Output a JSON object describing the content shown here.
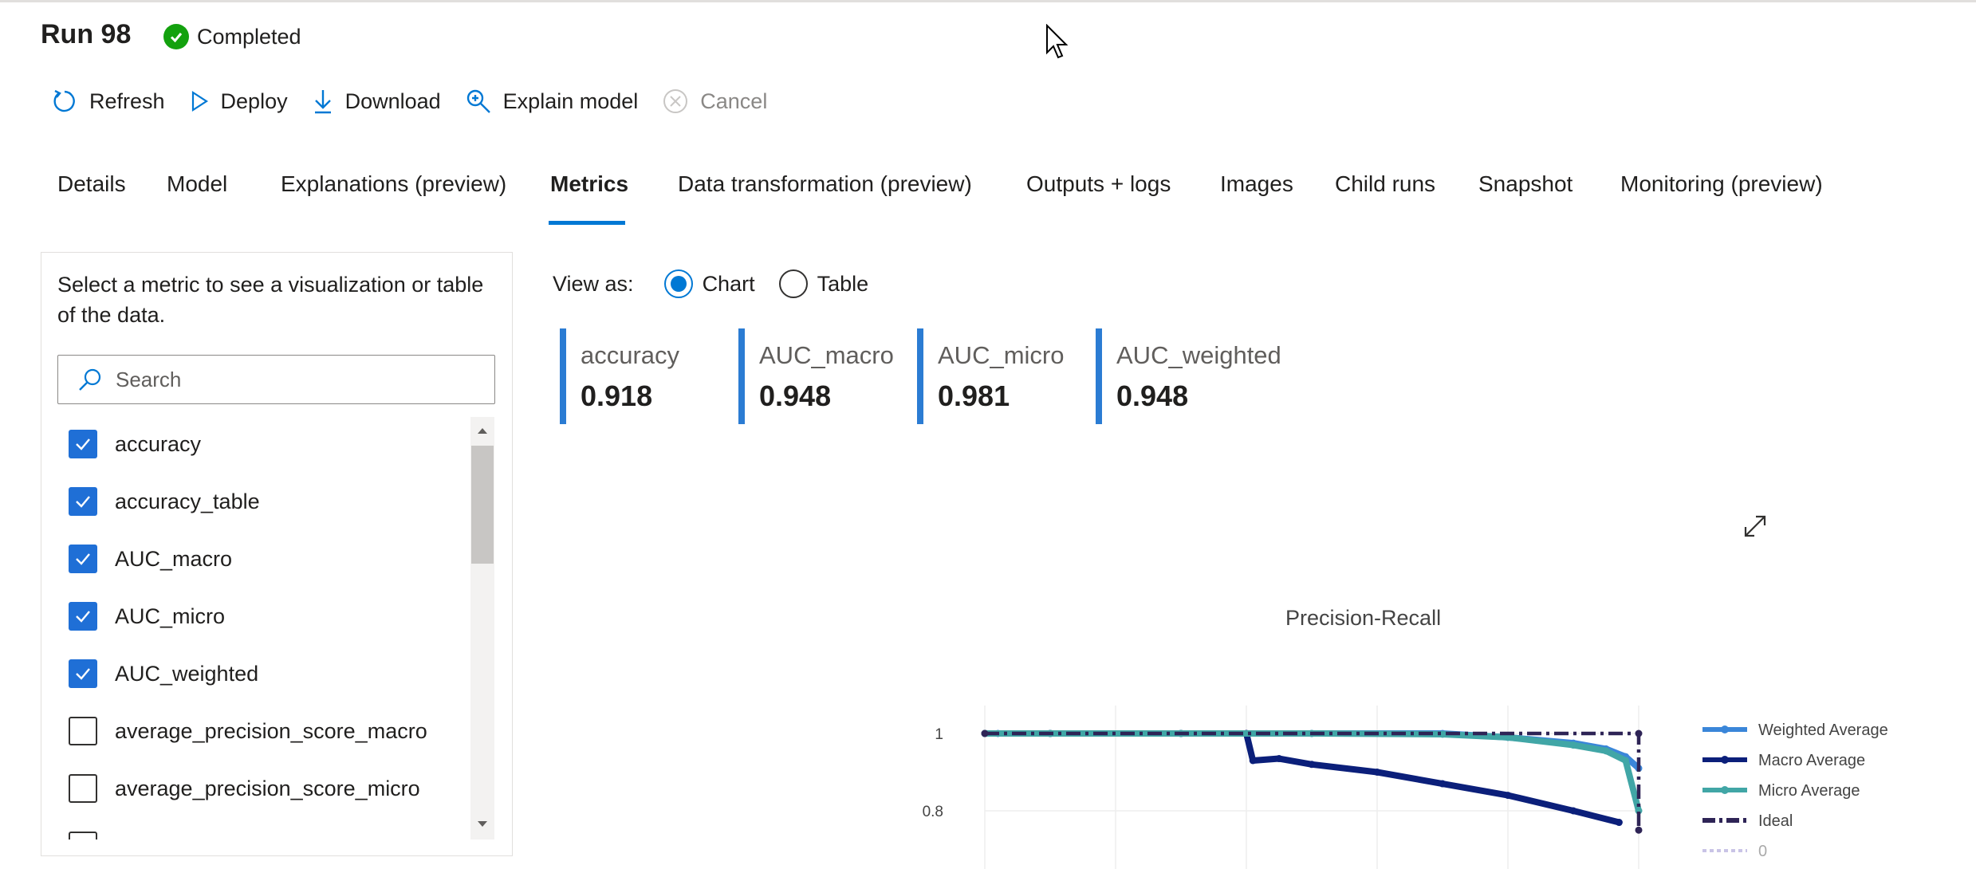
{
  "run": {
    "title": "Run 98",
    "status": "Completed"
  },
  "toolbar": {
    "refresh": "Refresh",
    "deploy": "Deploy",
    "download": "Download",
    "explain": "Explain model",
    "cancel": "Cancel"
  },
  "tabs": [
    "Details",
    "Model",
    "Explanations (preview)",
    "Metrics",
    "Data transformation (preview)",
    "Outputs + logs",
    "Images",
    "Child runs",
    "Snapshot",
    "Monitoring (preview)"
  ],
  "active_tab": "Metrics",
  "sidebar": {
    "hint": "Select a metric to see a visualization or table of the data.",
    "search_placeholder": "Search",
    "items": [
      {
        "label": "accuracy",
        "checked": true
      },
      {
        "label": "accuracy_table",
        "checked": true
      },
      {
        "label": "AUC_macro",
        "checked": true
      },
      {
        "label": "AUC_micro",
        "checked": true
      },
      {
        "label": "AUC_weighted",
        "checked": true
      },
      {
        "label": "average_precision_score_macro",
        "checked": false
      },
      {
        "label": "average_precision_score_micro",
        "checked": false
      }
    ]
  },
  "view": {
    "label": "View as:",
    "chart": "Chart",
    "table": "Table",
    "selected": "Chart"
  },
  "metrics": [
    {
      "label": "accuracy",
      "value": "0.918"
    },
    {
      "label": "AUC_macro",
      "value": "0.948"
    },
    {
      "label": "AUC_micro",
      "value": "0.981"
    },
    {
      "label": "AUC_weighted",
      "value": "0.948"
    }
  ],
  "colors": {
    "accent": "#0078d4",
    "metric_bar": "#2b7cd3",
    "weighted": "#3a86d9",
    "macro": "#0b1f7a",
    "micro": "#41a6a6",
    "ideal": "#2e2456"
  },
  "chart_data": {
    "type": "line",
    "title": "Precision-Recall",
    "yticks": [
      "1",
      "0.8"
    ],
    "ylim": [
      0.75,
      1.05
    ],
    "xlim": [
      0,
      1
    ],
    "legend_position": "right",
    "series": [
      {
        "name": "Weighted Average",
        "x": [
          0,
          0.02,
          0.1,
          0.3,
          0.5,
          0.7,
          0.8,
          0.9,
          0.95,
          0.98,
          1.0
        ],
        "y": [
          1,
          1,
          1,
          1,
          1,
          1,
          0.99,
          0.975,
          0.96,
          0.94,
          0.91
        ]
      },
      {
        "name": "Macro Average",
        "x": [
          0,
          0.1,
          0.3,
          0.4,
          0.41,
          0.45,
          0.5,
          0.6,
          0.7,
          0.8,
          0.9,
          0.97
        ],
        "y": [
          1,
          1,
          1,
          1,
          0.93,
          0.935,
          0.92,
          0.9,
          0.87,
          0.84,
          0.8,
          0.77
        ]
      },
      {
        "name": "Micro Average",
        "x": [
          0,
          0.1,
          0.3,
          0.5,
          0.7,
          0.8,
          0.9,
          0.95,
          0.98,
          1.0
        ],
        "y": [
          1,
          1,
          1,
          1,
          0.998,
          0.99,
          0.97,
          0.955,
          0.93,
          0.8
        ]
      },
      {
        "name": "Ideal",
        "x": [
          0,
          1,
          1
        ],
        "y": [
          1,
          1,
          0.75
        ]
      },
      {
        "name": "0"
      }
    ]
  }
}
